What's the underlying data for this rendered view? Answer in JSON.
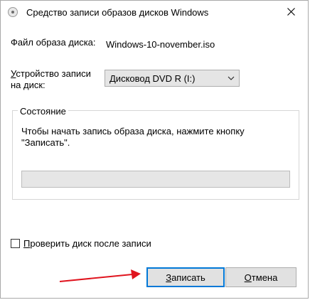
{
  "window": {
    "title": "Средство записи образов дисков Windows"
  },
  "image_row": {
    "label": "Файл образа диска:",
    "value": "Windows-10-november.iso"
  },
  "device_row": {
    "label_line1_first": "У",
    "label_line1_rest": "стройство записи",
    "label_line2": "на диск:",
    "selected": "Дисковод DVD R (I:)"
  },
  "status": {
    "legend": "Состояние",
    "text": "Чтобы начать запись образа диска, нажмите кнопку \"Записать\".",
    "progress_fraction": 0
  },
  "verify": {
    "checked": false,
    "label_first": "П",
    "label_rest": "роверить диск после записи"
  },
  "buttons": {
    "burn_first": "З",
    "burn_rest": "аписать",
    "cancel_first": "О",
    "cancel_rest": "тмена"
  },
  "colors": {
    "accent": "#0078d7",
    "annotation_arrow": "#e0141e"
  },
  "icons": {
    "app": "disc-icon",
    "close": "close-icon",
    "dropdown": "chevron-down-icon"
  }
}
